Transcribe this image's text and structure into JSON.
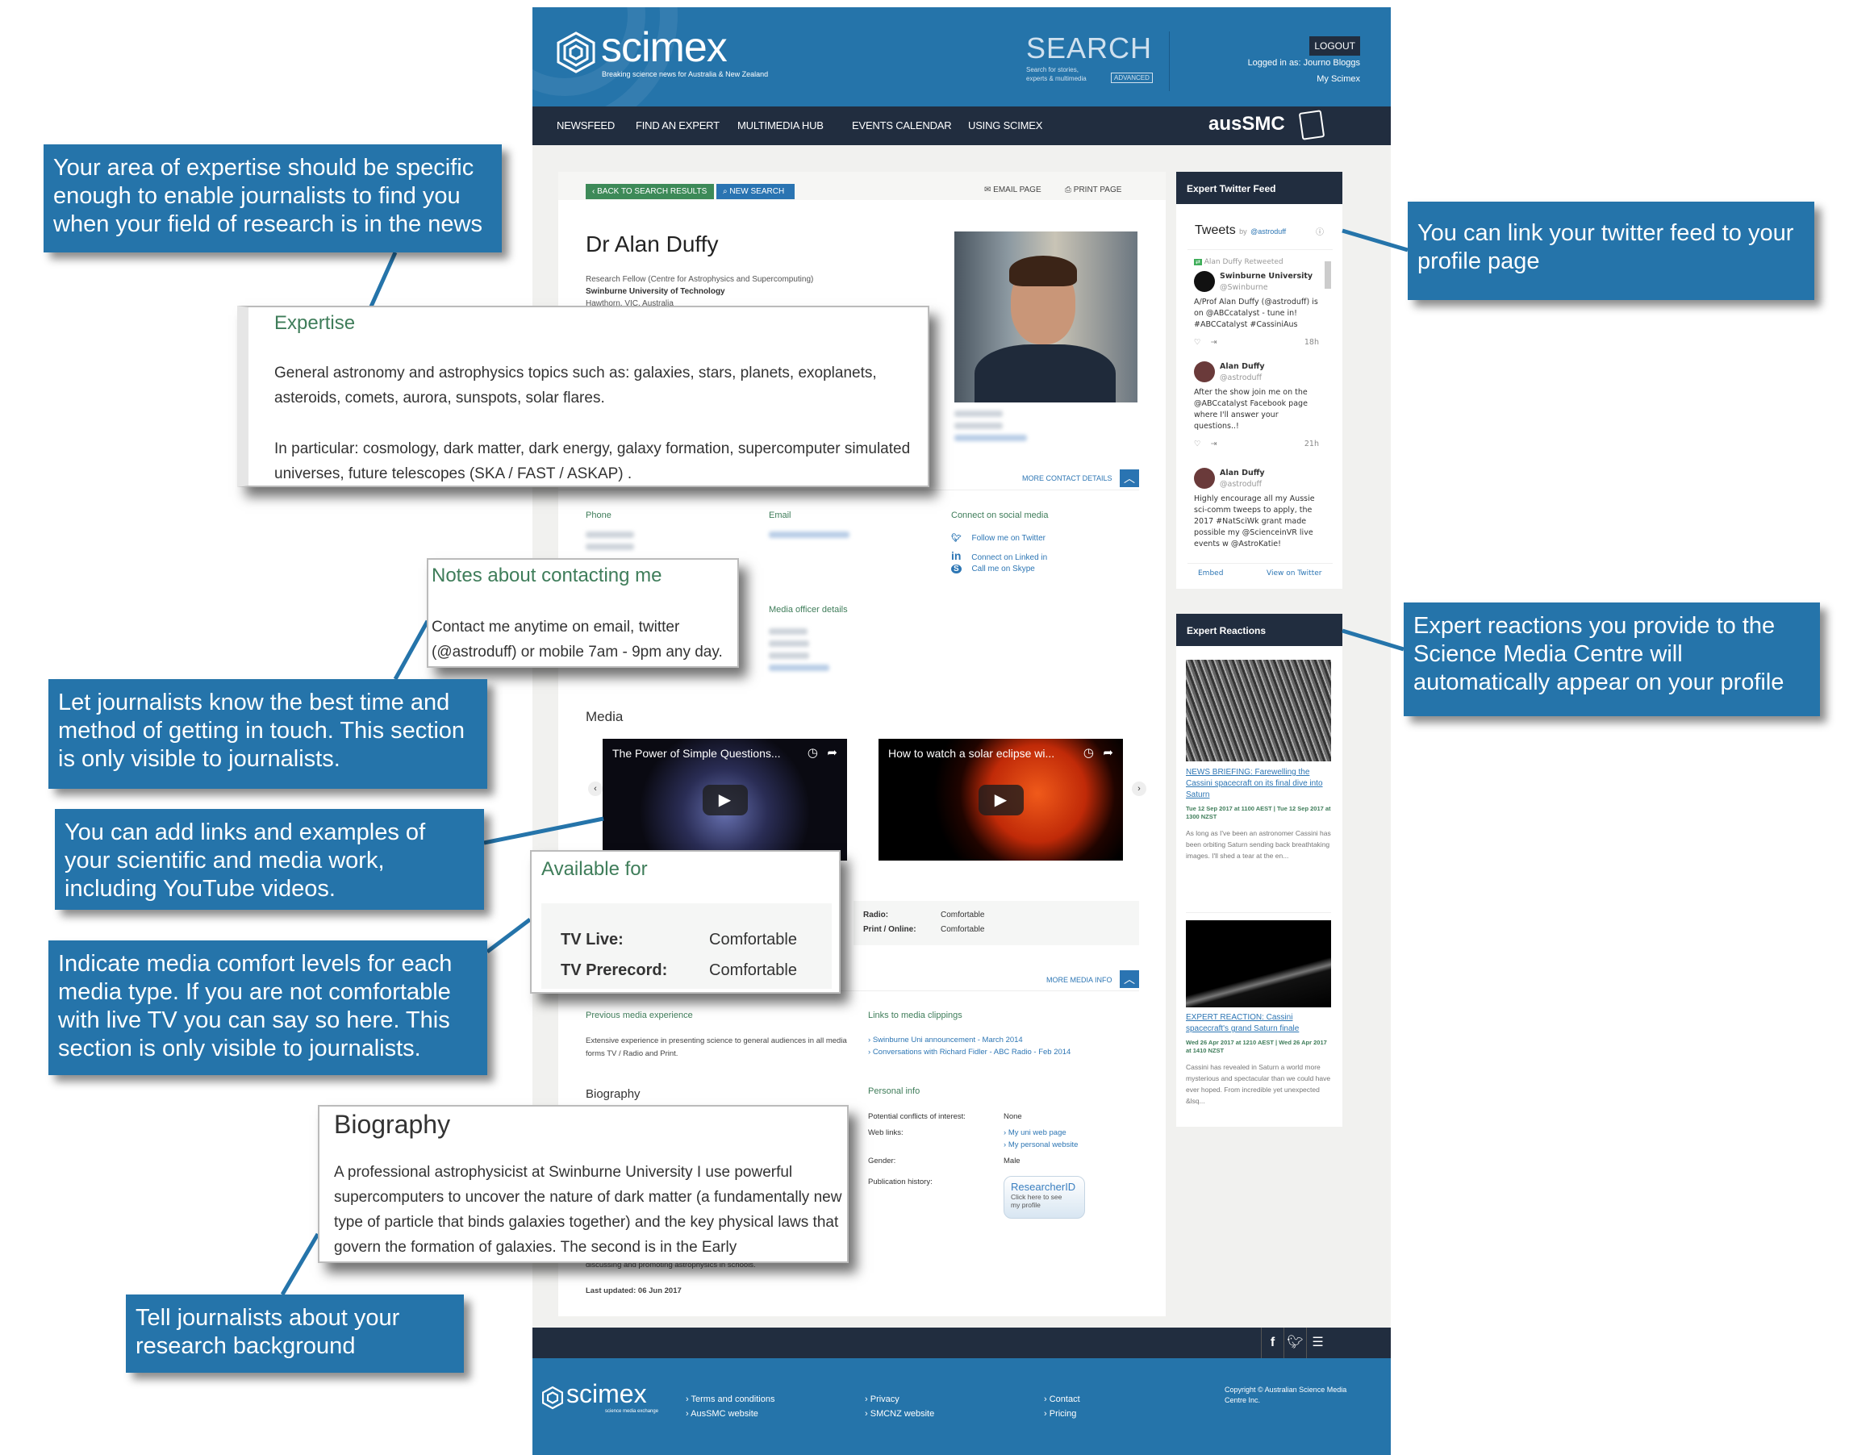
{
  "header": {
    "logo": "scimex",
    "tagline": "Breaking science news for Australia & New Zealand",
    "search_label": "SEARCH",
    "search_hint": "Search for stories, experts & multimedia",
    "advanced": "ADVANCED",
    "logout": "LOGOUT",
    "logged_in": "Logged in as: Journo Bloggs",
    "my_scimex": "My Scimex",
    "partner_logo": "ausSMC"
  },
  "nav": [
    "NEWSFEED",
    "FIND AN EXPERT",
    "MULTIMEDIA HUB",
    "EVENTS CALENDAR",
    "USING SCIMEX"
  ],
  "toolbar": {
    "back": "BACK TO SEARCH RESULTS",
    "new_search": "NEW SEARCH",
    "email_page": "EMAIL PAGE",
    "print_page": "PRINT PAGE"
  },
  "profile": {
    "name": "Dr Alan Duffy",
    "position": "Research Fellow (Centre for Astrophysics and Supercomputing)",
    "institution": "Swinburne University of Technology",
    "location": "Hawthorn, VIC, Australia",
    "more_contact": "MORE CONTACT DETAILS",
    "phone_label": "Phone",
    "email_label": "Email",
    "social_label": "Connect on social media",
    "social": [
      "Follow me on Twitter",
      "Connect on Linked in",
      "Call me on Skype"
    ],
    "media_officer_label": "Media officer details",
    "media_heading": "Media",
    "videos": [
      "The Power of Simple Questions...",
      "How to watch a solar eclipse wi..."
    ],
    "availability": [
      {
        "label": "Radio:",
        "value": "Comfortable"
      },
      {
        "label": "Print / Online:",
        "value": "Comfortable"
      }
    ],
    "more_media": "MORE MEDIA INFO",
    "prev_media_label": "Previous media experience",
    "prev_media_text": "Extensive experience in presenting science to general audiences in all media forms TV / Radio and Print.",
    "clippings_label": "Links to media clippings",
    "clippings": [
      "Swinburne Uni announcement - March 2014",
      "Conversations with Richard Fidler - ABC Radio - Feb 2014"
    ],
    "biography_heading": "Biography",
    "bio_tail": "discussing and promoting astrophysics in schools.",
    "last_updated": "Last updated: 06 Jun 2017",
    "personal_label": "Personal info",
    "personal": {
      "conflicts_label": "Potential conflicts of interest:",
      "conflicts": "None",
      "weblinks_label": "Web links:",
      "weblinks": [
        "My uni web page",
        "My personal website"
      ],
      "gender_label": "Gender:",
      "gender": "Male",
      "pub_label": "Publication history:",
      "researcher_id": "ResearcherID",
      "researcher_hint": "Click here to see my profile"
    }
  },
  "twitter": {
    "heading": "Expert Twitter Feed",
    "tweets_title": "Tweets",
    "by": "by",
    "handle": "@astroduff",
    "tweets": [
      {
        "retweet": "Alan Duffy Retweeted",
        "name": "Swinburne University",
        "user": "@Swinburne",
        "text": "A/Prof Alan Duffy (@astroduff) is on @ABCcatalyst - tune in! #ABCCatalyst #CassiniAus",
        "time": "18h"
      },
      {
        "name": "Alan Duffy",
        "user": "@astroduff",
        "text": "After the show join me on the @ABCcatalyst Facebook page where I'll answer your questions..!",
        "time": "21h"
      },
      {
        "name": "Alan Duffy",
        "user": "@astroduff",
        "text": "Highly encourage all my Aussie sci-comm tweeps to apply, the 2017 #NatSciWk grant made possible my @ScienceinVR live events w @AstroKatie!",
        "time": ""
      }
    ],
    "embed": "Embed",
    "view": "View on Twitter"
  },
  "reactions": {
    "heading": "Expert Reactions",
    "items": [
      {
        "title": "NEWS BRIEFING: Farewelling the Cassini spacecraft on its final dive into Saturn",
        "date": "Tue 12 Sep 2017 at 1100 AEST | Tue 12 Sep 2017 at 1300 NZST",
        "text": "As long as I've been an astronomer Cassini has been orbiting Saturn sending back breathtaking images. I'll shed a tear at the en..."
      },
      {
        "title": "EXPERT REACTION: Cassini spacecraft's grand Saturn finale",
        "date": "Wed 26 Apr 2017 at 1210 AEST | Wed 26 Apr 2017 at 1410 NZST",
        "text": "Cassini has revealed in Saturn a world more mysterious and spectacular than we could have ever hoped. From incredible yet unexpected &lsq..."
      }
    ]
  },
  "footer": {
    "logo": "scimex",
    "logo_sub": "science media exchange",
    "links": [
      "Terms and conditions",
      "AusSMC website",
      "Privacy",
      "SMCNZ website",
      "Contact",
      "Pricing"
    ],
    "copyright": "Copyright © Australian Science Media Centre Inc.",
    "social_icons": [
      "facebook-icon",
      "twitter-icon",
      "rss-icon"
    ]
  },
  "overlays": {
    "expertise_title": "Expertise",
    "expertise_p1": "General astronomy and astrophysics topics such as: galaxies, stars, planets, exoplanets, asteroids, comets, aurora, sunspots, solar flares.",
    "expertise_p2": "In particular: cosmology, dark matter, dark energy, galaxy formation, supercomputer simulated universes, future telescopes (SKA / FAST / ASKAP) .",
    "notes_title": "Notes about contacting me",
    "notes_text": "Contact me anytime on email, twitter (@astroduff) or mobile 7am - 9pm any day.",
    "available_title": "Available for",
    "available": [
      {
        "label": "TV Live:",
        "value": "Comfortable"
      },
      {
        "label": "TV Prerecord:",
        "value": "Comfortable"
      }
    ],
    "bio_title": "Biography",
    "bio_text": "A professional astrophysicist at Swinburne University I use powerful supercomputers to uncover the nature of dark matter (a fundamentally new type of particle that binds galaxies together) and the key physical laws that govern the formation of galaxies. The second is in the Early"
  },
  "callouts": {
    "expertise": "Your area of expertise should be specific enough to enable journalists to find you when your field of research is in the news",
    "twitter": "You can link your twitter feed to your profile page",
    "reactions": "Expert reactions you provide to the Science Media Centre will automatically appear on your profile",
    "contact": "Let journalists know the best time and method of getting in touch. This section is only visible to journalists.",
    "media": "You can add links and examples of your scientific and media work, including YouTube videos.",
    "comfort": "Indicate media comfort levels for each media type. If you are not comfortable with live TV you can say so here. This section is only visible to journalists.",
    "bio": "Tell journalists about your research background"
  },
  "colors": {
    "brand_blue": "#2574aa",
    "navy": "#212d3f",
    "green": "#3f7d5a",
    "link": "#2d76b4"
  }
}
